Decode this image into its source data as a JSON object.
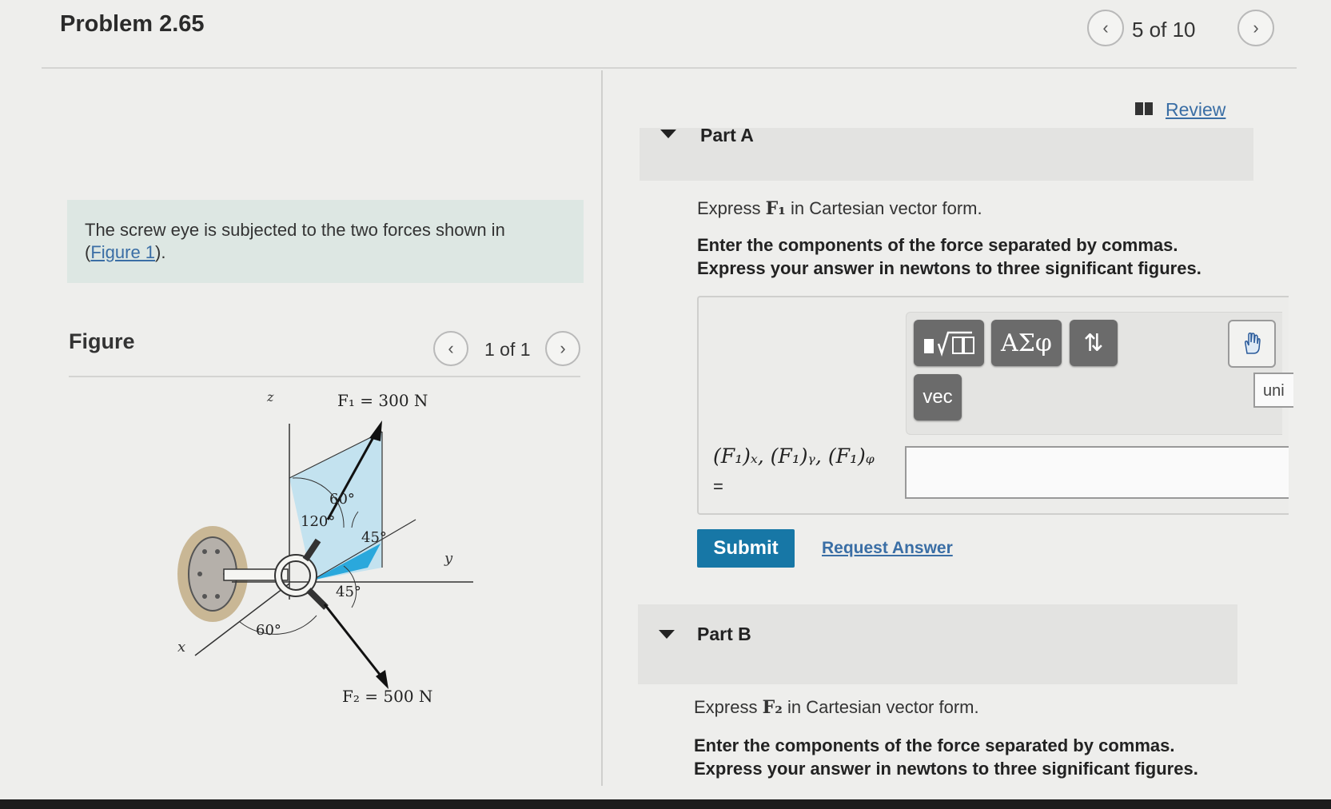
{
  "problem": {
    "title": "Problem 2.65"
  },
  "pager": {
    "text": "5 of 10",
    "prev_icon": "chevron-left-icon",
    "next_icon": "chevron-right-icon"
  },
  "intro": {
    "text_before": "The screw eye is subjected to the two forces shown in",
    "paren_open": "(",
    "figure_link": "Figure 1",
    "paren_close": ")."
  },
  "figure": {
    "heading": "Figure",
    "pager_text": "1 of 1",
    "labels": {
      "z": "z",
      "y": "y",
      "x": "x",
      "f1": "F₁ = 300 N",
      "f2": "F₂ = 500 N",
      "a60_top": "60°",
      "a120": "120°",
      "a45_right": "45°",
      "a45_low": "45°",
      "a60_low": "60°"
    }
  },
  "review": {
    "label": "Review",
    "icon": "book-icon"
  },
  "part_a": {
    "title": "Part A",
    "express_pre": "Express ",
    "express_sym": "F₁",
    "express_post": " in Cartesian vector form.",
    "instructions_1": "Enter the components of the force separated by commas.",
    "instructions_2": "Express your answer in newtons to three significant figures.",
    "toolbar": {
      "templates_icon": "math-templates-icon",
      "greek_label": "ΑΣφ",
      "arrows_label": "⇅",
      "vec_label": "vec",
      "hand_icon": "hand-pointer-icon",
      "units_label": "uni"
    },
    "answer_label": "(F₁)ₓ, (F₁)ᵧ, (F₁)ᵩ",
    "answer_eq": "=",
    "answer_value": "",
    "submit_label": "Submit",
    "request_label": "Request Answer"
  },
  "part_b": {
    "title": "Part B",
    "express_pre": "Express ",
    "express_sym": "F₂",
    "express_post": " in Cartesian vector form.",
    "instructions_1": "Enter the components of the force separated by commas.",
    "instructions_2": "Express your answer in newtons to three significant figures."
  },
  "colors": {
    "accent": "#1777a6",
    "link": "#3a6ea5",
    "intro_bg": "#dde7e3",
    "diagram_fill": "#b8dff0",
    "diagram_blue": "#2aa8dc"
  }
}
